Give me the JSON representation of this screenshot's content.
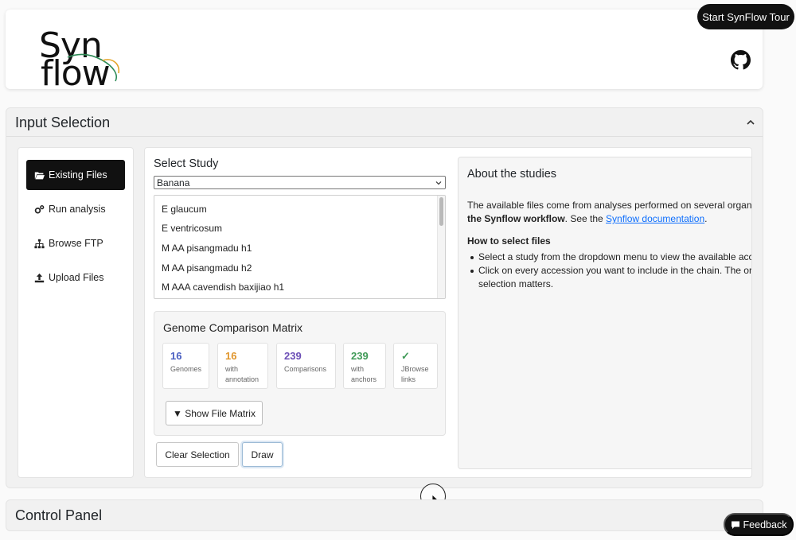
{
  "header": {
    "logo": {
      "line1": "Syn",
      "line2": "flow"
    },
    "tour_button": "Start SynFlow Tour"
  },
  "input_selection": {
    "title": "Input Selection",
    "nav": [
      {
        "label": "Existing Files",
        "icon": "folder-open-icon",
        "active": true
      },
      {
        "label": "Run analysis",
        "icon": "gears-icon"
      },
      {
        "label": "Browse FTP",
        "icon": "sitemap-icon"
      },
      {
        "label": "Upload Files",
        "icon": "upload-icon"
      }
    ],
    "select_study": {
      "title": "Select Study",
      "selected": "Banana",
      "genomes": [
        "E glaucum",
        "E ventricosum",
        "M AA pisangmadu h1",
        "M AA pisangmadu h2",
        "M AAA cavendish baxijiao h1"
      ]
    },
    "matrix": {
      "title": "Genome Comparison Matrix",
      "stats": [
        {
          "value": "16",
          "label_1": "Genomes",
          "label_2": "",
          "color": "#4a5fc1"
        },
        {
          "value": "16",
          "label_1": "with",
          "label_2": "annotation",
          "color": "#e0952b"
        },
        {
          "value": "239",
          "label_1": "Comparisons",
          "label_2": "",
          "color": "#6c4fb6"
        },
        {
          "value": "239",
          "label_1": "with",
          "label_2": "anchors",
          "color": "#3f9a57"
        },
        {
          "value": "✓",
          "label_1": "JBrowse",
          "label_2": "links",
          "color": "#3f9a57"
        }
      ],
      "show_button": "▼ Show File Matrix"
    },
    "buttons": {
      "clear": "Clear Selection",
      "draw": "Draw"
    },
    "about": {
      "title": "About the studies",
      "p1_line1": "The available files come from analyses performed on several organis",
      "p1_bold": "the Synflow workflow",
      "p1_mid": ". See the ",
      "p1_link": "Synflow documentation",
      "p1_end": ".",
      "howto_title": "How to select files",
      "bullet1": "Select a study from the dropdown menu to view the available acce",
      "bullet2_line1": "Click on every accession you want to include in the chain. The ord",
      "bullet2_line2": "selection matters."
    }
  },
  "control_panel": {
    "title": "Control Panel"
  },
  "feedback_button": "Feedback"
}
